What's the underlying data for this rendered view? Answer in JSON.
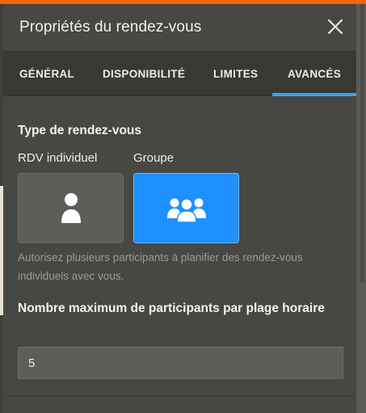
{
  "dialog": {
    "title": "Propriétés du rendez-vous"
  },
  "tabs": [
    {
      "label": "GÉNÉRAL"
    },
    {
      "label": "DISPONIBILITÉ"
    },
    {
      "label": "LIMITES"
    },
    {
      "label": "AVANCÉS",
      "active": true
    }
  ],
  "appointment_type": {
    "title": "Type de rendez-vous",
    "options": [
      {
        "label": "RDV individuel",
        "icon": "person-icon",
        "selected": false
      },
      {
        "label": "Groupe",
        "icon": "group-icon",
        "selected": true
      }
    ],
    "hint": "Autorisez plusieurs participants à planifier des rendez-vous individuels avec vous."
  },
  "max_participants": {
    "label": "Nombre maximum de participants par plage horaire",
    "value": "5"
  },
  "colors": {
    "accent": "#3aa2f2",
    "selected_card": "#1e90ff",
    "top_bar": "#f0640f"
  }
}
